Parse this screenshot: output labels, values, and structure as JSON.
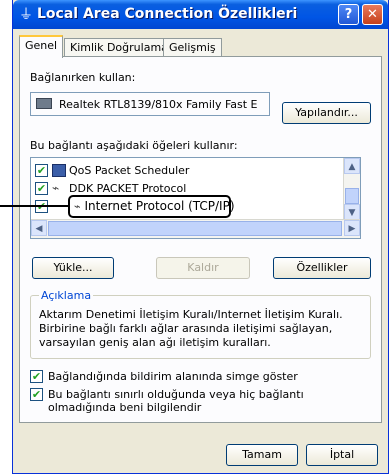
{
  "window": {
    "title": "Local Area Connection Özellikleri",
    "help_label": "?",
    "close_label": "✕",
    "icon": "network-icon"
  },
  "tabs": [
    {
      "label": "Genel",
      "active": true
    },
    {
      "label": "Kimlik Doğrulama",
      "active": false
    },
    {
      "label": "Gelişmiş",
      "active": false
    }
  ],
  "connect_using": {
    "label": "Bağlanırken kullan:",
    "adapter_name": "Realtek RTL8139/810x Family Fast E",
    "configure_button": "Yapılandır..."
  },
  "items_section": {
    "label": "Bu bağlantı aşağıdaki öğeleri kullanır:",
    "items": [
      {
        "label": "QoS Packet Scheduler",
        "checked": true,
        "icon": "scheduler-icon"
      },
      {
        "label": "DDK PACKET Protocol",
        "checked": true,
        "icon": "protocol-icon"
      },
      {
        "label": "Internet Protocol (TCP/IP)",
        "checked": true,
        "icon": "protocol-icon"
      }
    ]
  },
  "buttons": {
    "install": "Yükle...",
    "uninstall": "Kaldır",
    "properties": "Özellikler",
    "ok": "Tamam",
    "cancel": "İptal"
  },
  "description": {
    "legend": "Açıklama",
    "text": "Aktarım Denetimi İletişim Kuralı/Internet İletişim Kuralı. Birbirine bağlı farklı ağlar arasında iletişimi sağlayan, varsayılan geniş alan ağı iletişim kuralları."
  },
  "options": [
    {
      "label": "Bağlandığında bildirim alanında simge göster",
      "checked": true
    },
    {
      "label": "Bu bağlantı sınırlı olduğunda veya hiç bağlantı olmadığında beni bilgilendir",
      "checked": true
    }
  ],
  "colors": {
    "title_bar": "#0055e5",
    "face": "#ece9d8",
    "accent_tab": "#ffc83c"
  }
}
